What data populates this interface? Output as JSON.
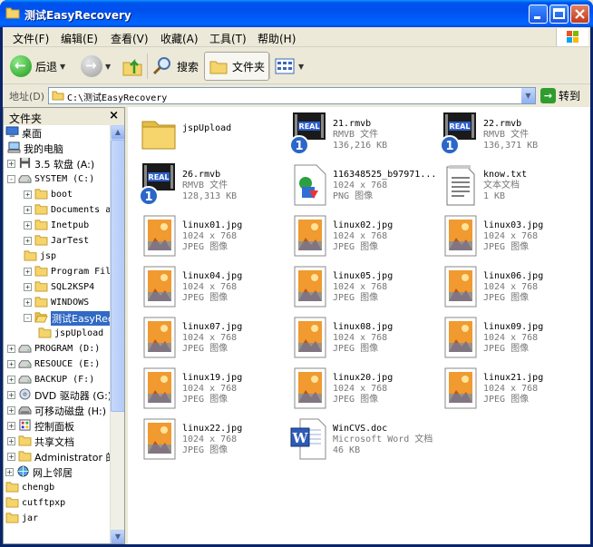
{
  "window": {
    "title": "测试EasyRecovery"
  },
  "menu": [
    "文件(F)",
    "编辑(E)",
    "查看(V)",
    "收藏(A)",
    "工具(T)",
    "帮助(H)"
  ],
  "toolbar": {
    "back": "后退",
    "search": "搜索",
    "folders": "文件夹"
  },
  "address": {
    "label": "地址(D)",
    "path": "C:\\测试EasyRecovery",
    "go": "转到"
  },
  "folder_pane": {
    "title": "文件夹",
    "close": "×",
    "tree": [
      {
        "label": "桌面",
        "icon": "desktop-icon",
        "indent": 0,
        "expander": ""
      },
      {
        "label": "我的电脑",
        "icon": "computer-icon",
        "indent": 1,
        "expander": ""
      },
      {
        "label": "3.5 软盘 (A:)",
        "icon": "floppy-icon",
        "indent": 1,
        "expander": "+"
      },
      {
        "label": "SYSTEM (C:)",
        "icon": "drive-icon",
        "indent": 1,
        "expander": "-"
      },
      {
        "label": "boot",
        "icon": "folder-icon",
        "indent": 2,
        "expander": "+"
      },
      {
        "label": "Documents and Settings",
        "icon": "folder-icon",
        "indent": 2,
        "expander": "+"
      },
      {
        "label": "Inetpub",
        "icon": "folder-icon",
        "indent": 2,
        "expander": "+"
      },
      {
        "label": "JarTest",
        "icon": "folder-icon",
        "indent": 2,
        "expander": "+"
      },
      {
        "label": "jsp",
        "icon": "folder-icon",
        "indent": 2,
        "expander": ""
      },
      {
        "label": "Program Files",
        "icon": "folder-icon",
        "indent": 2,
        "expander": "+"
      },
      {
        "label": "SQL2KSP4",
        "icon": "folder-icon",
        "indent": 2,
        "expander": "+"
      },
      {
        "label": "WINDOWS",
        "icon": "folder-icon",
        "indent": 2,
        "expander": "+"
      },
      {
        "label": "测试EasyRecovery",
        "icon": "folder-open-icon",
        "indent": 2,
        "expander": "-",
        "selected": true
      },
      {
        "label": "jspUpload",
        "icon": "folder-icon",
        "indent": 3,
        "expander": ""
      },
      {
        "label": "PROGRAM (D:)",
        "icon": "drive-icon",
        "indent": 1,
        "expander": "+"
      },
      {
        "label": "RESOUCE (E:)",
        "icon": "drive-icon",
        "indent": 1,
        "expander": "+"
      },
      {
        "label": "BACKUP (F:)",
        "icon": "drive-icon",
        "indent": 1,
        "expander": "+"
      },
      {
        "label": "DVD 驱动器 (G:)",
        "icon": "dvd-icon",
        "indent": 1,
        "expander": "+"
      },
      {
        "label": "可移动磁盘 (H:)",
        "icon": "removable-disk-icon",
        "indent": 1,
        "expander": "+"
      },
      {
        "label": "控制面板",
        "icon": "control-panel-icon",
        "indent": 1,
        "expander": "+"
      },
      {
        "label": "共享文档",
        "icon": "folder-icon",
        "indent": 1,
        "expander": "+"
      },
      {
        "label": "Administrator 的文档",
        "icon": "folder-icon",
        "indent": 1,
        "expander": "+"
      },
      {
        "label": "网上邻居",
        "icon": "network-icon",
        "indent": 0,
        "expander": "+"
      },
      {
        "label": "chengb",
        "icon": "folder-icon",
        "indent": 0,
        "expander": ""
      },
      {
        "label": "cutftpxp",
        "icon": "folder-icon",
        "indent": 0,
        "expander": ""
      },
      {
        "label": "jar",
        "icon": "folder-icon",
        "indent": 0,
        "expander": ""
      }
    ]
  },
  "files": [
    {
      "name": "jspUpload",
      "type": "",
      "detail": "",
      "icon": "folder-icon"
    },
    {
      "name": "21.rmvb",
      "type": "RMVB 文件",
      "detail": "136,216 KB",
      "icon": "realplayer-icon"
    },
    {
      "name": "22.rmvb",
      "type": "RMVB 文件",
      "detail": "136,371 KB",
      "icon": "realplayer-icon"
    },
    {
      "name": "26.rmvb",
      "type": "RMVB 文件",
      "detail": "128,313 KB",
      "icon": "realplayer-icon"
    },
    {
      "name": "116348525_b97971...",
      "type": "1024 x 768",
      "detail": "PNG 图像",
      "icon": "png-image-icon"
    },
    {
      "name": "know.txt",
      "type": "文本文档",
      "detail": "1 KB",
      "icon": "text-file-icon"
    },
    {
      "name": "linux01.jpg",
      "type": "1024 x 768",
      "detail": "JPEG 图像",
      "icon": "jpeg-image-icon"
    },
    {
      "name": "linux02.jpg",
      "type": "1024 x 768",
      "detail": "JPEG 图像",
      "icon": "jpeg-image-icon"
    },
    {
      "name": "linux03.jpg",
      "type": "1024 x 768",
      "detail": "JPEG 图像",
      "icon": "jpeg-image-icon"
    },
    {
      "name": "linux04.jpg",
      "type": "1024 x 768",
      "detail": "JPEG 图像",
      "icon": "jpeg-image-icon"
    },
    {
      "name": "linux05.jpg",
      "type": "1024 x 768",
      "detail": "JPEG 图像",
      "icon": "jpeg-image-icon"
    },
    {
      "name": "linux06.jpg",
      "type": "1024 x 768",
      "detail": "JPEG 图像",
      "icon": "jpeg-image-icon"
    },
    {
      "name": "linux07.jpg",
      "type": "1024 x 768",
      "detail": "JPEG 图像",
      "icon": "jpeg-image-icon"
    },
    {
      "name": "linux08.jpg",
      "type": "1024 x 768",
      "detail": "JPEG 图像",
      "icon": "jpeg-image-icon"
    },
    {
      "name": "linux09.jpg",
      "type": "1024 x 768",
      "detail": "JPEG 图像",
      "icon": "jpeg-image-icon"
    },
    {
      "name": "linux19.jpg",
      "type": "1024 x 768",
      "detail": "JPEG 图像",
      "icon": "jpeg-image-icon"
    },
    {
      "name": "linux20.jpg",
      "type": "1024 x 768",
      "detail": "JPEG 图像",
      "icon": "jpeg-image-icon"
    },
    {
      "name": "linux21.jpg",
      "type": "1024 x 768",
      "detail": "JPEG 图像",
      "icon": "jpeg-image-icon"
    },
    {
      "name": "linux22.jpg",
      "type": "1024 x 768",
      "detail": "JPEG 图像",
      "icon": "jpeg-image-icon"
    },
    {
      "name": "WinCVS.doc",
      "type": "Microsoft Word 文档",
      "detail": "46 KB",
      "icon": "word-document-icon"
    }
  ],
  "colors": {
    "title_bar": "#0055ea",
    "selection": "#316ac5",
    "window_bg": "#ece9d8"
  }
}
